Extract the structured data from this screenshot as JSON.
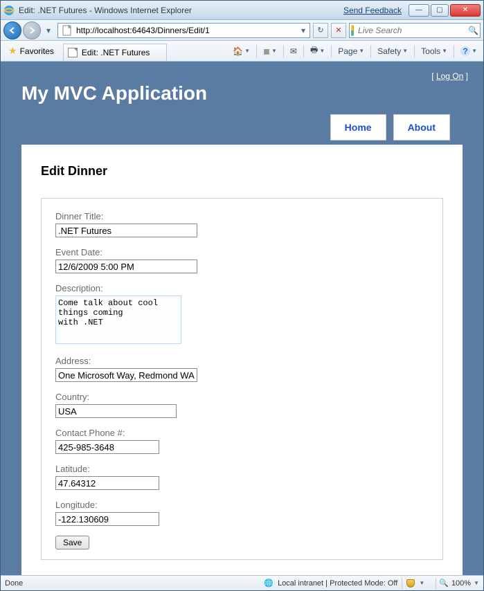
{
  "window": {
    "title": "Edit: .NET Futures - Windows Internet Explorer",
    "feedback": "Send Feedback"
  },
  "nav": {
    "url": "http://localhost:64643/Dinners/Edit/1",
    "search_placeholder": "Live Search"
  },
  "favbar": {
    "favorites": "Favorites",
    "tab_title": "Edit: .NET Futures",
    "page": "Page",
    "safety": "Safety",
    "tools": "Tools"
  },
  "site": {
    "logon_left": "[",
    "logon": "Log On",
    "logon_right": "]",
    "title": "My MVC Application",
    "nav_home": "Home",
    "nav_about": "About"
  },
  "form": {
    "heading": "Edit Dinner",
    "title_label": "Dinner Title:",
    "title_value": ".NET Futures",
    "date_label": "Event Date:",
    "date_value": "12/6/2009 5:00 PM",
    "desc_label": "Description:",
    "desc_value": "Come talk about cool things coming\nwith .NET",
    "address_label": "Address:",
    "address_value": "One Microsoft Way, Redmond WA",
    "country_label": "Country:",
    "country_value": "USA",
    "phone_label": "Contact Phone #:",
    "phone_value": "425-985-3648",
    "lat_label": "Latitude:",
    "lat_value": "47.64312",
    "lon_label": "Longitude:",
    "lon_value": "-122.130609",
    "save": "Save"
  },
  "status": {
    "left": "Done",
    "zone": "Local intranet | Protected Mode: Off",
    "zoom": "100%"
  }
}
